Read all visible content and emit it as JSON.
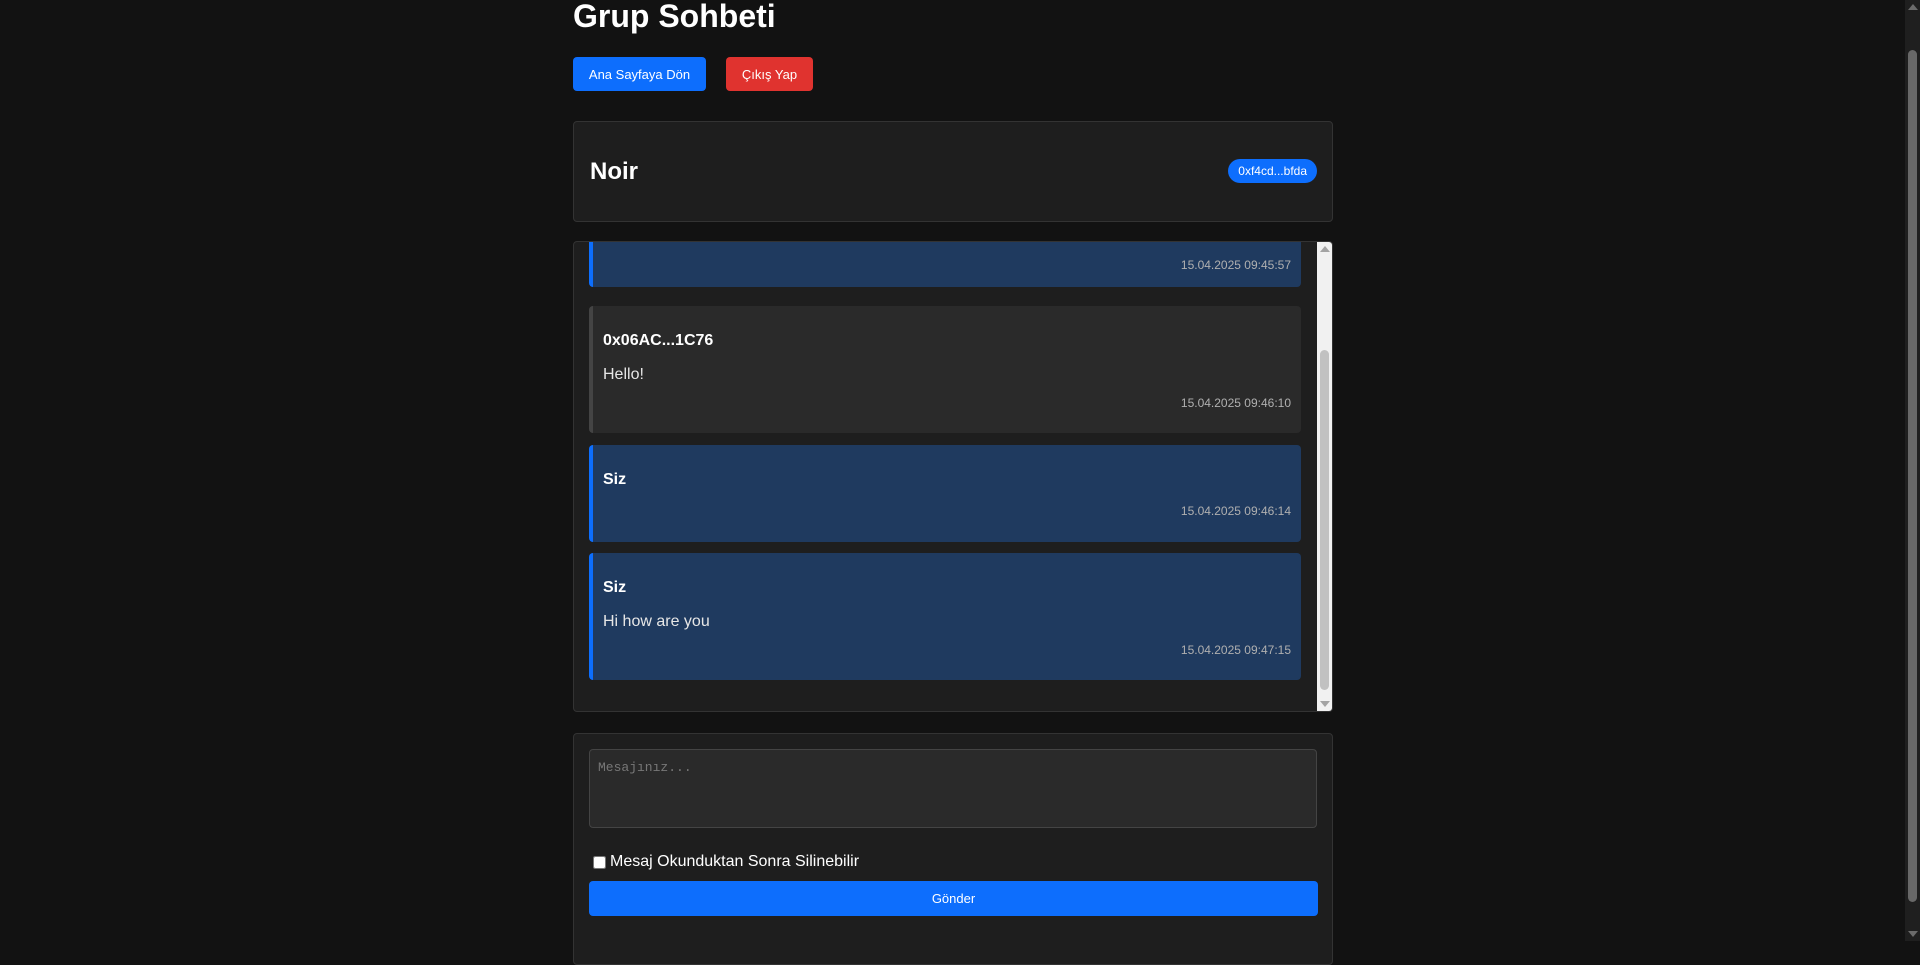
{
  "header": {
    "title": "Grup Sohbeti",
    "home_button": "Ana Sayfaya Dön",
    "logout_button": "Çıkış Yap"
  },
  "group": {
    "name": "Noir",
    "address_badge": "0xf4cd...bfda"
  },
  "messages": [
    {
      "sender": "",
      "text": "",
      "time": "15.04.2025 09:45:57",
      "own": true
    },
    {
      "sender": "0x06AC...1C76",
      "text": "Hello!",
      "time": "15.04.2025 09:46:10",
      "own": false
    },
    {
      "sender": "Siz",
      "text": "",
      "time": "15.04.2025 09:46:14",
      "own": true
    },
    {
      "sender": "Siz",
      "text": "Hi how are you",
      "time": "15.04.2025 09:47:15",
      "own": true
    }
  ],
  "compose": {
    "placeholder": "Mesajınız...",
    "delete_after_read_label": "Mesaj Okunduktan Sonra Silinebilir",
    "delete_after_read_checked": false,
    "send_button": "Gönder"
  },
  "colors": {
    "background": "#121212",
    "card": "#1e1e1e",
    "accent": "#0d6efd",
    "danger": "#e0332f",
    "own_message": "#1f3a5f",
    "other_message": "#2a2a2a"
  },
  "icons": {
    "scroll_up": "triangle-up-icon",
    "scroll_down": "triangle-down-icon"
  }
}
